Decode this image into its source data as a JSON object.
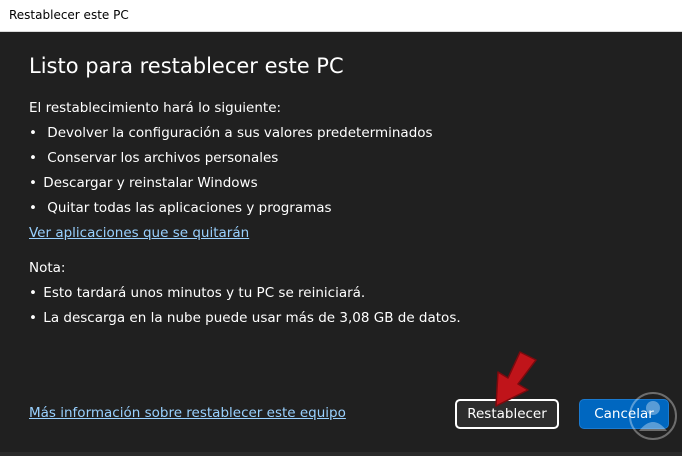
{
  "window": {
    "title": "Restablecer este PC"
  },
  "main": {
    "heading": "Listo para restablecer este PC",
    "intro": "El restablecimiento hará lo siguiente:",
    "bullets": [
      "Devolver la configuración a sus valores predeterminados",
      "Conservar los archivos personales",
      "Descargar y reinstalar Windows",
      "Quitar todas las aplicaciones y programas"
    ],
    "bullet_symbol": "•",
    "apps_link": "Ver aplicaciones que se quitarán",
    "note_label": "Nota:",
    "notes": [
      "Esto tardará unos minutos y tu PC se reiniciará.",
      "La descarga en la nube puede usar más de 3,08 GB de datos."
    ]
  },
  "footer": {
    "more_info_link": "Más información sobre restablecer este equipo",
    "reset_button": "Restablecer",
    "cancel_button": "Cancelar"
  },
  "colors": {
    "background": "#202020",
    "link": "#99d1ff",
    "accent": "#0067c0",
    "arrow": "#c0141a"
  },
  "icons": {
    "annotation_arrow": "red-arrow-icon",
    "watermark": "person-silhouette-watermark-icon"
  }
}
